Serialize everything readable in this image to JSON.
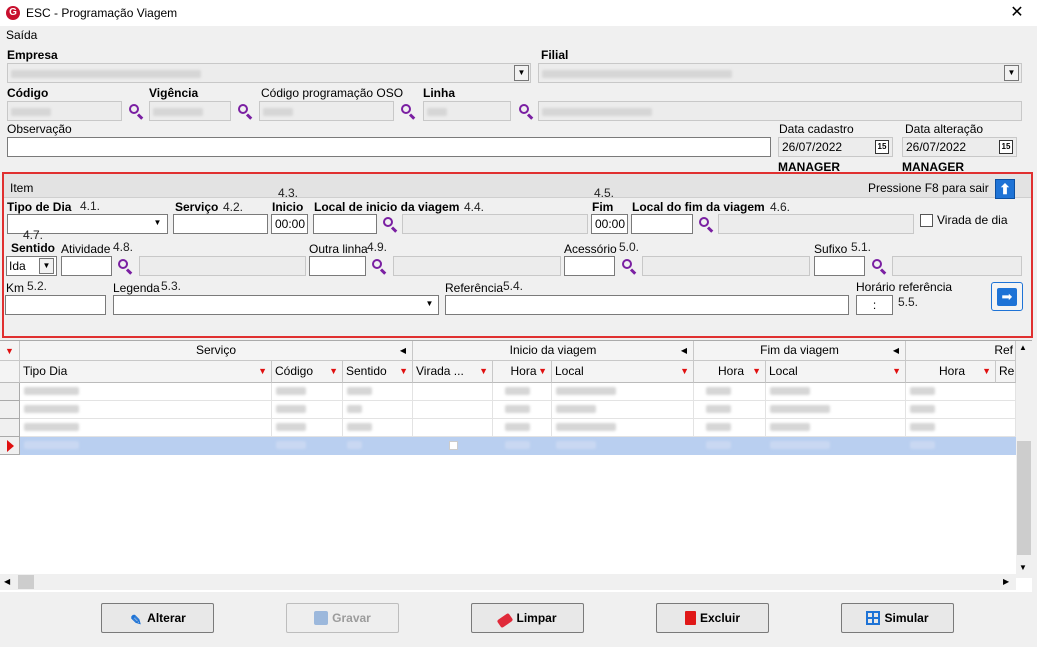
{
  "window": {
    "title": "ESC - Programação Viagem",
    "icon": "G"
  },
  "menu": {
    "saida": "Saída"
  },
  "form": {
    "empresa_label": "Empresa",
    "filial_label": "Filial",
    "codigo_label": "Código",
    "vigencia_label": "Vigência",
    "codigo_oso_label": "Código programação OSO",
    "linha_label": "Linha",
    "observacao_label": "Observação",
    "data_cadastro_label": "Data cadastro",
    "data_cadastro": "26/07/2022",
    "data_alteracao_label": "Data alteração",
    "data_alteracao": "26/07/2022",
    "user_cadastro": "MANAGER",
    "user_alteracao": "MANAGER",
    "cal_icon_text": "15"
  },
  "item": {
    "header": "Item",
    "exit_hint": "Pressione F8 para sair",
    "tipo_dia_label": "Tipo de Dia",
    "tipo_dia_num": "4.1.",
    "servico_label": "Serviço",
    "servico_num": "4.2.",
    "inicio_label": "Inicio",
    "inicio_num": "4.3.",
    "inicio_value": "00:00",
    "local_inicio_label": "Local de inicio da viagem",
    "local_inicio_num": "4.4.",
    "fim_label": "Fim",
    "fim_num": "4.5.",
    "fim_value": "00:00",
    "local_fim_label": "Local do fim da viagem",
    "local_fim_num": "4.6.",
    "virada_dia_label": "Virada de dia",
    "sentido_label": "Sentido",
    "sentido_num": "4.7.",
    "sentido_value": "Ida",
    "atividade_label": "Atividade",
    "atividade_num": "4.8.",
    "outra_linha_label": "Outra linha",
    "outra_linha_num": "4.9.",
    "acessorio_label": "Acessório",
    "acessorio_num": "5.0.",
    "sufixo_label": "Sufixo",
    "sufixo_num": "5.1.",
    "km_label": "Km",
    "km_num": "5.2.",
    "legenda_label": "Legenda",
    "legenda_num": "5.3.",
    "referencia_label": "Referência",
    "referencia_num": "5.4.",
    "horario_ref_label": "Horário referência",
    "horario_ref_num": "5.5.",
    "horario_ref_value": ":"
  },
  "grid": {
    "group_servico": "Serviço",
    "group_inicio": "Inicio da viagem",
    "group_fim": "Fim da viagem",
    "group_ref": "Ref",
    "col_tipo_dia": "Tipo Dia",
    "col_codigo": "Código",
    "col_sentido": "Sentido",
    "col_virada": "Virada ...",
    "col_hora_ini": "Hora",
    "col_local_ini": "Local",
    "col_hora_fim": "Hora",
    "col_local_fim": "Local",
    "col_hora_ref": "Hora",
    "col_re": "Re"
  },
  "buttons": {
    "alterar": "Alterar",
    "gravar": "Gravar",
    "limpar": "Limpar",
    "excluir": "Excluir",
    "simular": "Simular"
  },
  "colors": {
    "accent": "#1e73d6",
    "highlight_box": "#e03030",
    "selected_row": "#b9cff0",
    "search_icon": "#7a1fa2"
  }
}
